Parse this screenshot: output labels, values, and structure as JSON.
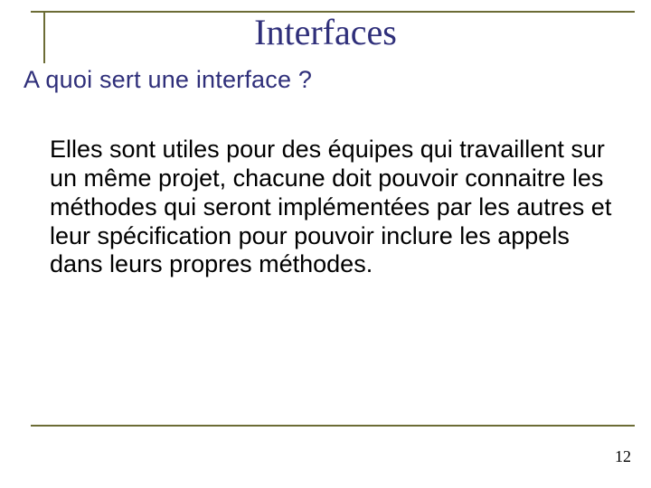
{
  "title": "Interfaces",
  "subtitle": "A quoi sert une interface ?",
  "body": "Elles sont utiles pour des équipes qui travaillent sur un même projet, chacune doit pouvoir connaitre les méthodes qui seront implémentées par les autres et leur spécification pour pouvoir inclure les appels dans leurs propres méthodes.",
  "page_number": "12"
}
